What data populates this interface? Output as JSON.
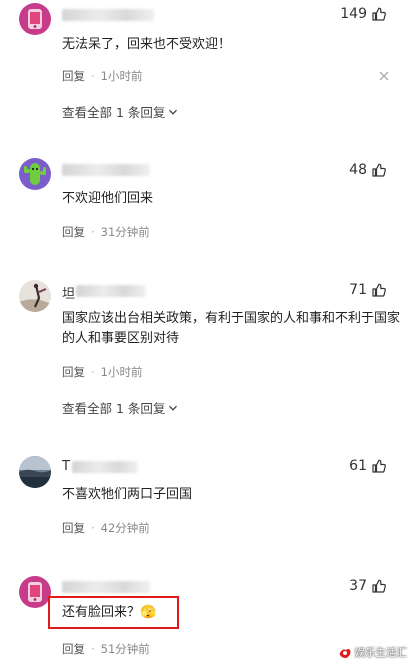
{
  "comments": [
    {
      "likes": "149",
      "text": "无法呆了，回来也不受欢迎！",
      "reply_label": "回复",
      "time": "1小时前",
      "expand_label": "查看全部 1 条回复"
    },
    {
      "likes": "48",
      "text": "不欢迎他们回来",
      "reply_label": "回复",
      "time": "31分钟前"
    },
    {
      "name_prefix": "坦",
      "likes": "71",
      "text": "国家应该出台相关政策，有利于国家的人和事和不利于国家的人和事要区别对待",
      "reply_label": "回复",
      "time": "1小时前",
      "expand_label": "查看全部 1 条回复"
    },
    {
      "name_prefix": "T",
      "likes": "61",
      "text": "不喜欢牠们两口子回国",
      "reply_label": "回复",
      "time": "42分钟前"
    },
    {
      "likes": "37",
      "text": "还有脸回来？🫣",
      "reply_label": "回复",
      "time": "51分钟前"
    }
  ],
  "meta_separator": "·",
  "watermark": "娱乐生活汇",
  "icons": {
    "like": "thumbs-up-icon",
    "close": "close-icon",
    "expand": "chevron-down-icon"
  },
  "colors": {
    "highlight_border": "#e0191a",
    "meta_text": "#888888"
  }
}
